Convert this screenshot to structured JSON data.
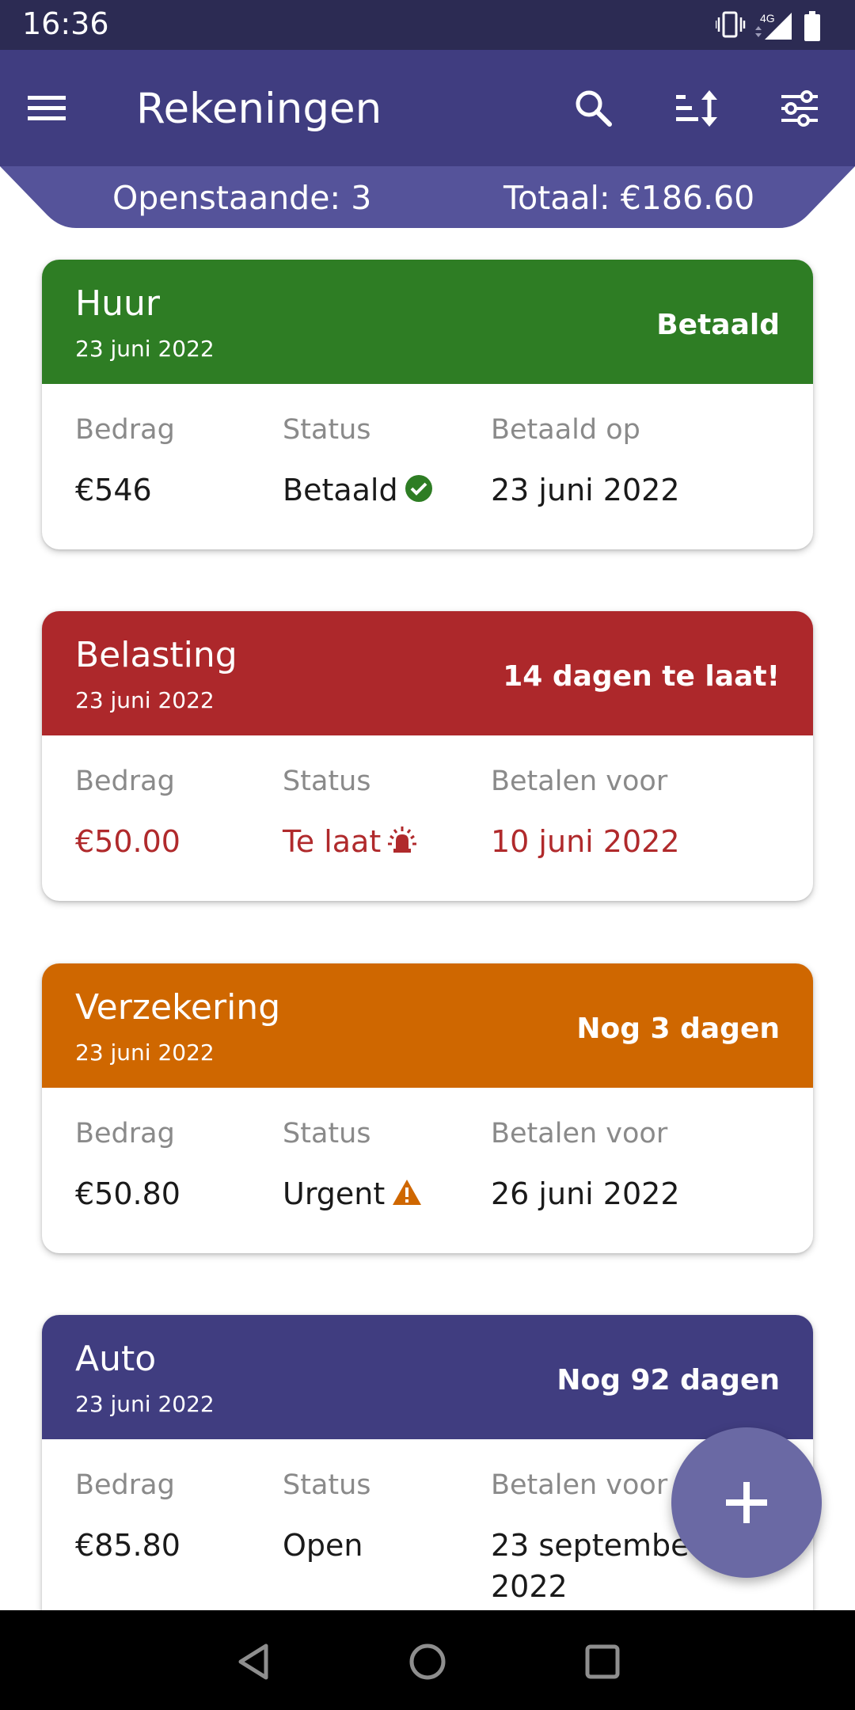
{
  "status_bar": {
    "time": "16:36",
    "network": "4G",
    "icons": [
      "vibrate-icon",
      "signal-icon",
      "battery-icon"
    ]
  },
  "app_bar": {
    "title": "Rekeningen",
    "icons": [
      "menu-icon",
      "search-icon",
      "sort-icon",
      "filter-icon"
    ]
  },
  "summary": {
    "open": "Openstaande: 3",
    "total": "Totaal: €186.60"
  },
  "bills": [
    {
      "name": "Huur",
      "date": "23 juni 2022",
      "badge": "Betaald",
      "color": "#2e7d24",
      "amount_label": "Bedrag",
      "amount": "€546",
      "status_label": "Status",
      "status": "Betaald",
      "status_icon": "check-circle-icon",
      "date_label": "Betaald op",
      "due": "23 juni 2022"
    },
    {
      "name": "Belasting",
      "date": "23 juni 2022",
      "badge": "14 dagen te laat!",
      "color": "#ad282b",
      "amount_label": "Bedrag",
      "amount": "€50.00",
      "status_label": "Status",
      "status": "Te laat",
      "status_icon": "siren-icon",
      "date_label": "Betalen voor",
      "due": "10 juni 2022"
    },
    {
      "name": "Verzekering",
      "date": "23 juni 2022",
      "badge": "Nog 3 dagen",
      "color": "#cf6700",
      "amount_label": "Bedrag",
      "amount": "€50.80",
      "status_label": "Status",
      "status": "Urgent",
      "status_icon": "warning-icon",
      "date_label": "Betalen voor",
      "due": "26 juni 2022"
    },
    {
      "name": "Auto",
      "date": "23 juni 2022",
      "badge": "Nog 92 dagen",
      "color": "#403d80",
      "amount_label": "Bedrag",
      "amount": "€85.80",
      "status_label": "Status",
      "status": "Open",
      "status_icon": "",
      "date_label": "Betalen voor",
      "due": "23 septembe",
      "due_line2": "2022"
    }
  ],
  "fab": {
    "icon": "plus-icon"
  },
  "nav_bar": {
    "icons": [
      "back-icon",
      "home-icon",
      "recents-icon"
    ]
  },
  "colors": {
    "status_bar": "#2c2b53",
    "app_bar": "#403d80",
    "summary_bar": "#55539a",
    "fab": "#6a69a4",
    "late_text": "#b02a2c"
  }
}
